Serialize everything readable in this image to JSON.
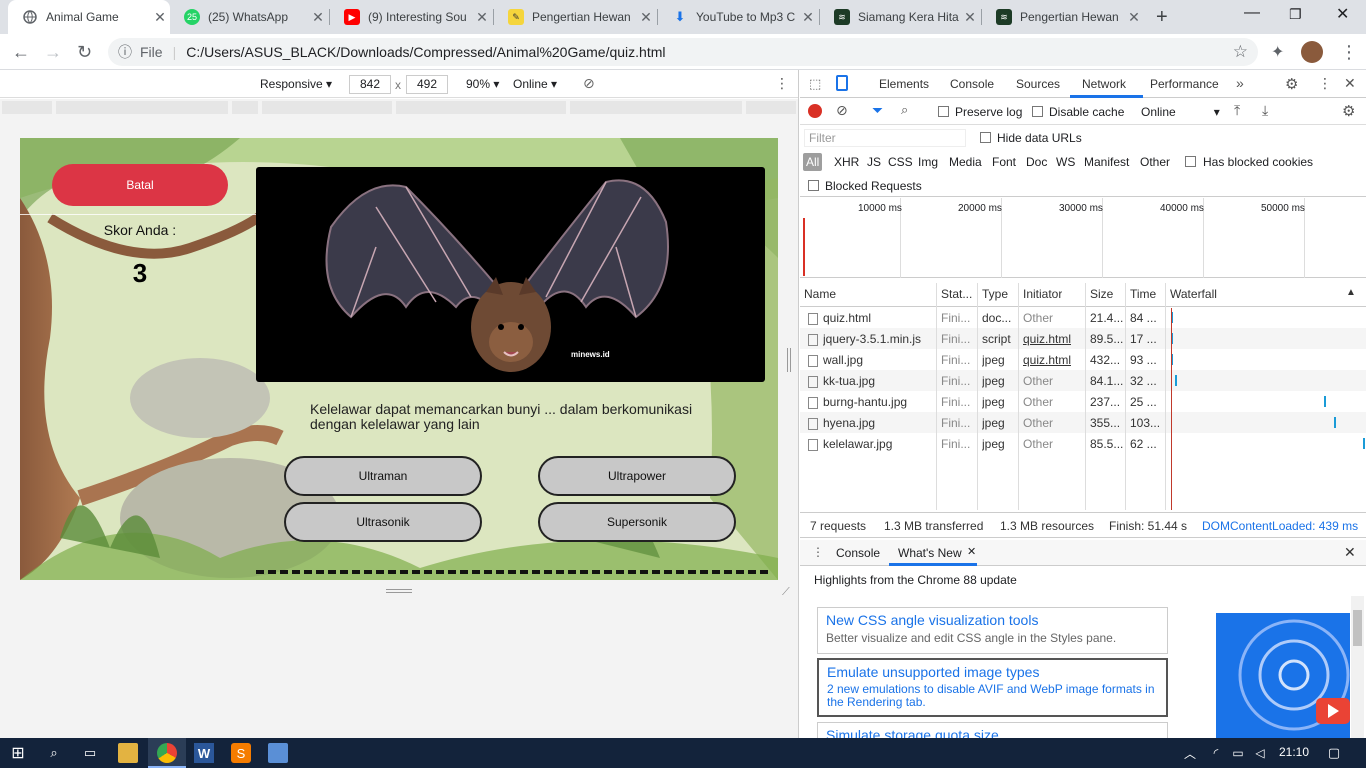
{
  "tabs": [
    {
      "title": "Animal Game",
      "icon": "globe-icon",
      "active": true
    },
    {
      "title": "(25) WhatsApp",
      "icon": "whatsapp-icon",
      "badge": "25"
    },
    {
      "title": "(9) Interesting Sou",
      "icon": "youtube-icon"
    },
    {
      "title": "Pengertian Hewan",
      "icon": "bookmark-icon"
    },
    {
      "title": "YouTube to Mp3 C",
      "icon": "download-icon"
    },
    {
      "title": "Siamang Kera Hita",
      "icon": "site-icon"
    },
    {
      "title": "Pengertian Hewan",
      "icon": "site-icon"
    }
  ],
  "address": {
    "scheme_label": "File",
    "url": "C:/Users/ASUS_BLACK/Downloads/Compressed/Animal%20Game/quiz.html"
  },
  "device_toolbar": {
    "mode": "Responsive",
    "width": "842",
    "times": "x",
    "height": "492",
    "zoom": "90%",
    "throttle": "Online"
  },
  "game": {
    "cancel_label": "Batal",
    "score_label": "Skor Anda :",
    "score_value": "3",
    "image_watermark": "minews.id",
    "question": "Kelelawar dapat memancarkan bunyi ... dalam berkomunikasi dengan kelelawar yang lain",
    "answers": [
      "Ultraman",
      "Ultrapower",
      "Ultrasonik",
      "Supersonik"
    ]
  },
  "devtools": {
    "tabs": [
      "Elements",
      "Console",
      "Sources",
      "Network",
      "Performance"
    ],
    "active_tab": "Network",
    "toolbar": {
      "preserve_log": "Preserve log",
      "disable_cache": "Disable cache",
      "throttle": "Online"
    },
    "filter_placeholder": "Filter",
    "hide_data_urls": "Hide data URLs",
    "type_filters": [
      "All",
      "XHR",
      "JS",
      "CSS",
      "Img",
      "Media",
      "Font",
      "Doc",
      "WS",
      "Manifest",
      "Other"
    ],
    "has_blocked_cookies": "Has blocked cookies",
    "blocked_requests": "Blocked Requests",
    "timeline_ticks": [
      "10000 ms",
      "20000 ms",
      "30000 ms",
      "40000 ms",
      "50000 ms"
    ],
    "columns": [
      "Name",
      "Stat...",
      "Type",
      "Initiator",
      "Size",
      "Time",
      "Waterfall"
    ],
    "rows": [
      {
        "name": "quiz.html",
        "status": "Fini...",
        "type": "doc...",
        "initiator": "Other",
        "size": "21.4...",
        "time": "84 ...",
        "link": false,
        "wf": 0.0
      },
      {
        "name": "jquery-3.5.1.min.js",
        "status": "Fini...",
        "type": "script",
        "initiator": "quiz.html",
        "size": "89.5...",
        "time": "17 ...",
        "link": true,
        "wf": 0.0
      },
      {
        "name": "wall.jpg",
        "status": "Fini...",
        "type": "jpeg",
        "initiator": "quiz.html",
        "size": "432...",
        "time": "93 ...",
        "link": true,
        "wf": 0.0
      },
      {
        "name": "kk-tua.jpg",
        "status": "Fini...",
        "type": "jpeg",
        "initiator": "Other",
        "size": "84.1...",
        "time": "32 ...",
        "link": false,
        "wf": 0.02
      },
      {
        "name": "burng-hantu.jpg",
        "status": "Fini...",
        "type": "jpeg",
        "initiator": "Other",
        "size": "237...",
        "time": "25 ...",
        "link": false,
        "wf": 0.79
      },
      {
        "name": "hyena.jpg",
        "status": "Fini...",
        "type": "jpeg",
        "initiator": "Other",
        "size": "355...",
        "time": "103...",
        "link": false,
        "wf": 0.84
      },
      {
        "name": "kelelawar.jpg",
        "status": "Fini...",
        "type": "jpeg",
        "initiator": "Other",
        "size": "85.5...",
        "time": "62 ...",
        "link": false,
        "wf": 0.99
      }
    ],
    "summary": {
      "requests": "7 requests",
      "transferred": "1.3 MB transferred",
      "resources": "1.3 MB resources",
      "finish": "Finish: 51.44 s",
      "dcl": "DOMContentLoaded: 439 ms"
    },
    "drawer": {
      "tabs": [
        "Console",
        "What's New"
      ],
      "heading": "Highlights from the Chrome 88 update",
      "cards": [
        {
          "title": "New CSS angle visualization tools",
          "desc": "Better visualize and edit CSS angle in the Styles pane."
        },
        {
          "title": "Emulate unsupported image types",
          "desc": "2 new emulations to disable AVIF and WebP image formats in the Rendering tab."
        },
        {
          "title": "Simulate storage quota size",
          "desc": ""
        }
      ]
    }
  },
  "taskbar": {
    "time": "21:10"
  },
  "colors": {
    "cancel": "#dc3545",
    "record": "#d93025",
    "link": "#1a73e8"
  }
}
